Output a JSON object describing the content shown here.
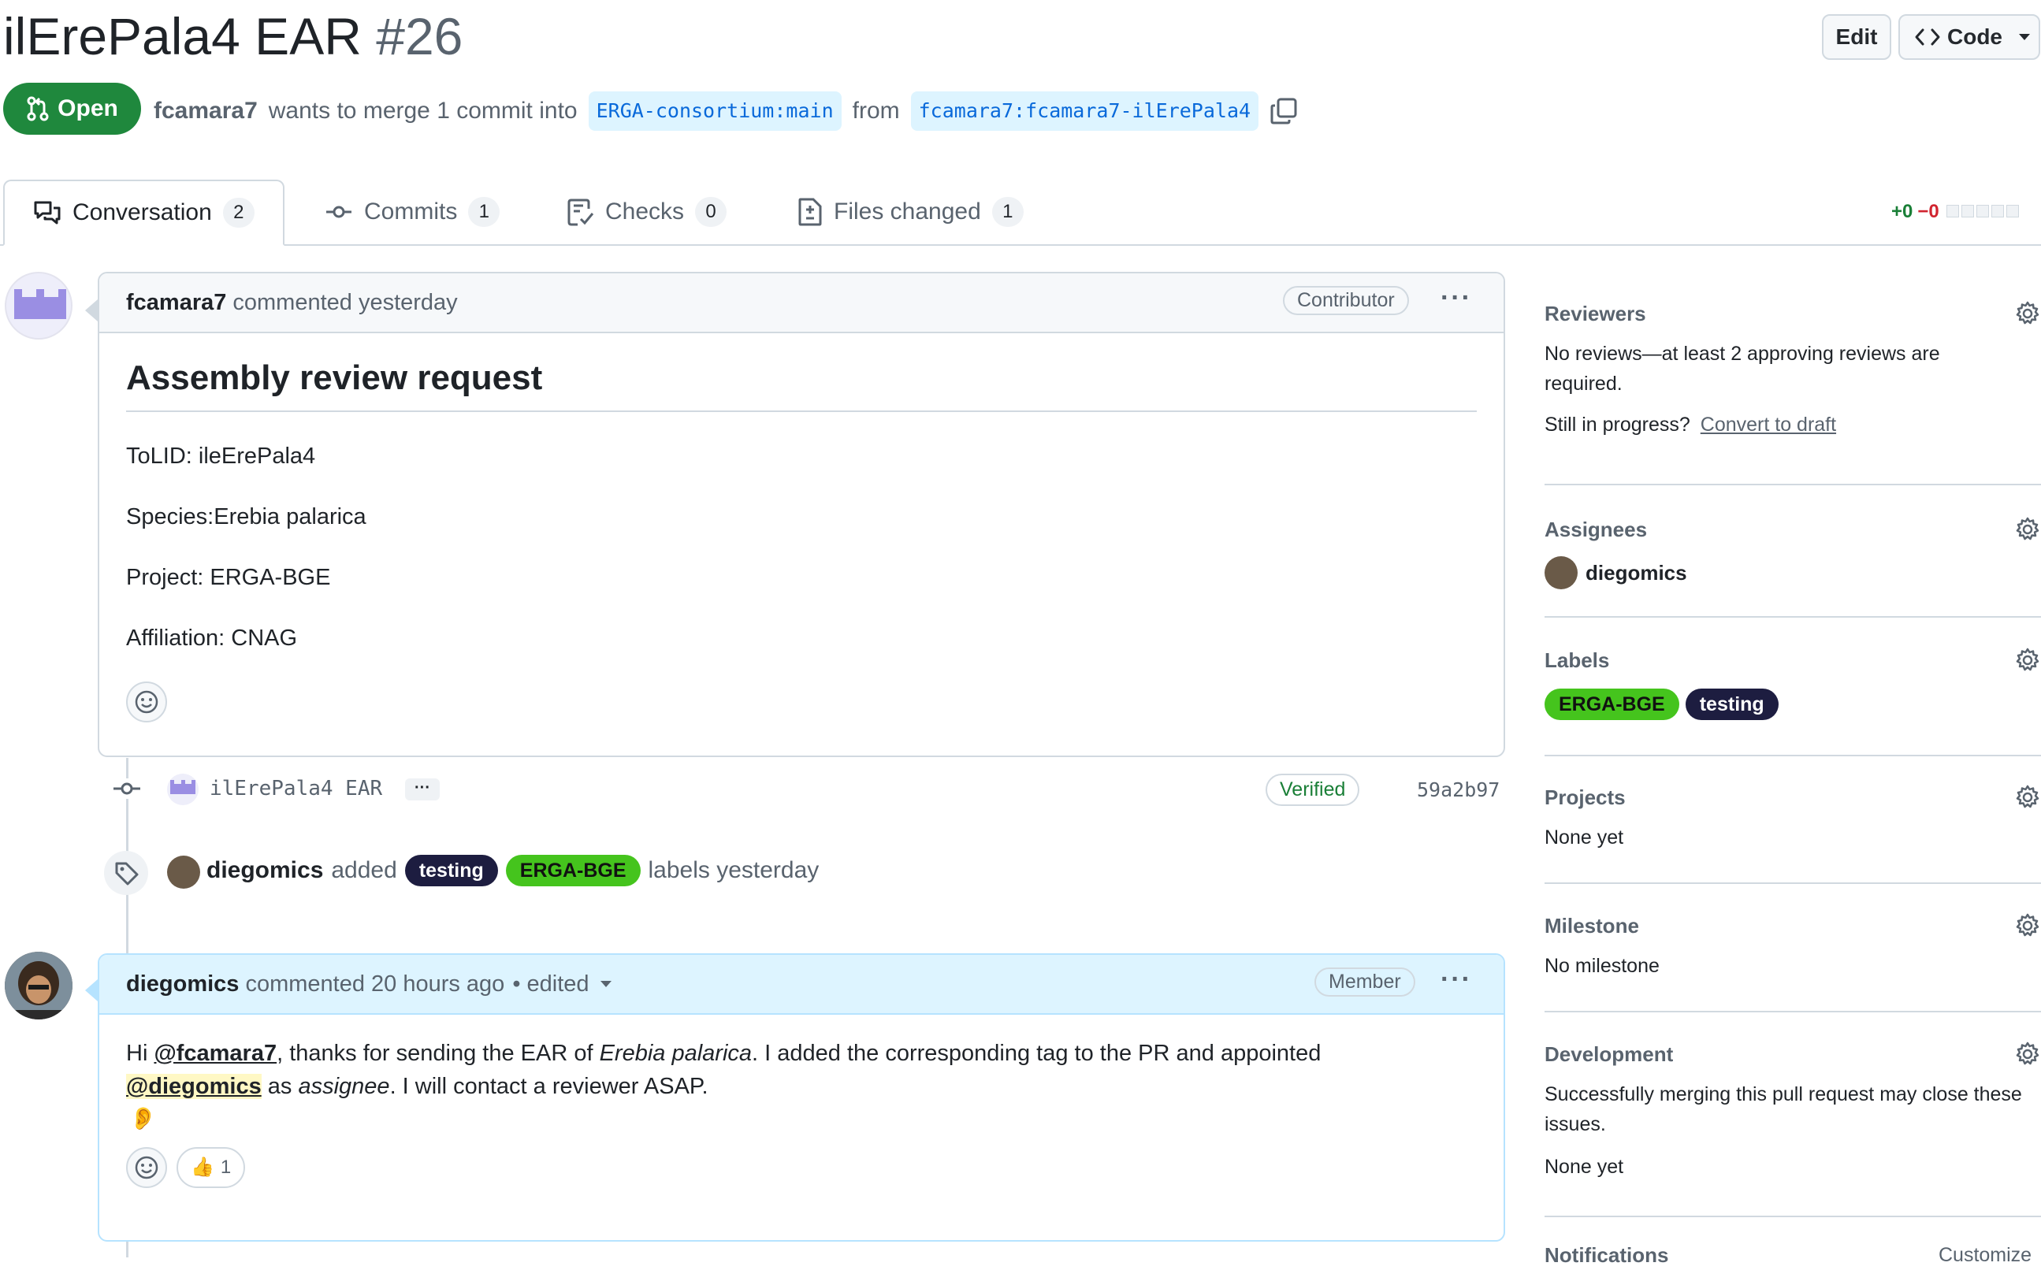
{
  "header": {
    "title": "ilErePala4 EAR",
    "number": "#26",
    "edit_label": "Edit",
    "code_label": "Code",
    "state": "Open",
    "author": "fcamara7",
    "merge_text": "wants to merge 1 commit into",
    "base_branch": "ERGA-consortium:main",
    "from_text": "from",
    "head_branch": "fcamara7:fcamara7-ilErePala4"
  },
  "tabs": [
    {
      "label": "Conversation",
      "count": "2",
      "icon": "comment-discussion-icon"
    },
    {
      "label": "Commits",
      "count": "1",
      "icon": "git-commit-icon"
    },
    {
      "label": "Checks",
      "count": "0",
      "icon": "checklist-icon"
    },
    {
      "label": "Files changed",
      "count": "1",
      "icon": "file-diff-icon"
    }
  ],
  "diffstat": {
    "additions": "+0",
    "deletions": "−0"
  },
  "first_comment": {
    "author": "fcamara7",
    "meta": "commented yesterday",
    "role": "Contributor",
    "heading": "Assembly review request",
    "lines": [
      "ToLID: ileErePala4",
      "Species:Erebia palarica",
      "Project: ERGA-BGE",
      "Affiliation: CNAG"
    ]
  },
  "commit": {
    "message": "ilErePala4 EAR",
    "ellipsis": "···",
    "verified": "Verified",
    "sha": "59a2b97"
  },
  "label_event": {
    "actor": "diegomics",
    "verb": "added",
    "label1": "testing",
    "label2": "ERGA-BGE",
    "suffix": "labels yesterday"
  },
  "second_comment": {
    "author": "diegomics",
    "meta": "commented 20 hours ago",
    "edited": "• edited",
    "role": "Member",
    "p1_a": "Hi ",
    "mention1": "@fcamara7",
    "p1_b": ", thanks for sending the EAR of ",
    "species_italic": "Erebia palarica",
    "p1_c": ". I added the corresponding tag to the PR and appointed",
    "mention2": "@diegomics",
    "p2_a": " as ",
    "assignee_italic": "assignee",
    "p2_b": ". I will contact a reviewer ASAP.",
    "ear_emoji": "👂",
    "reaction_emoji": "👍",
    "reaction_count": "1"
  },
  "sidebar": {
    "reviewers_title": "Reviewers",
    "reviewers_text": "No reviews—at least 2 approving reviews are required.",
    "draft_prompt": "Still in progress?",
    "draft_link": "Convert to draft",
    "assignees_title": "Assignees",
    "assignee": "diegomics",
    "labels_title": "Labels",
    "label1": "ERGA-BGE",
    "label2": "testing",
    "projects_title": "Projects",
    "projects_text": "None yet",
    "milestone_title": "Milestone",
    "milestone_text": "No milestone",
    "development_title": "Development",
    "development_text": "Successfully merging this pull request may close these issues.",
    "development_none": "None yet",
    "notifications_title": "Notifications",
    "notifications_link": "Customize"
  },
  "colors": {
    "open_green": "#1f883d",
    "link_blue": "#0969da",
    "label_testing": "#1d1d40",
    "label_erga": "#45c41d"
  }
}
